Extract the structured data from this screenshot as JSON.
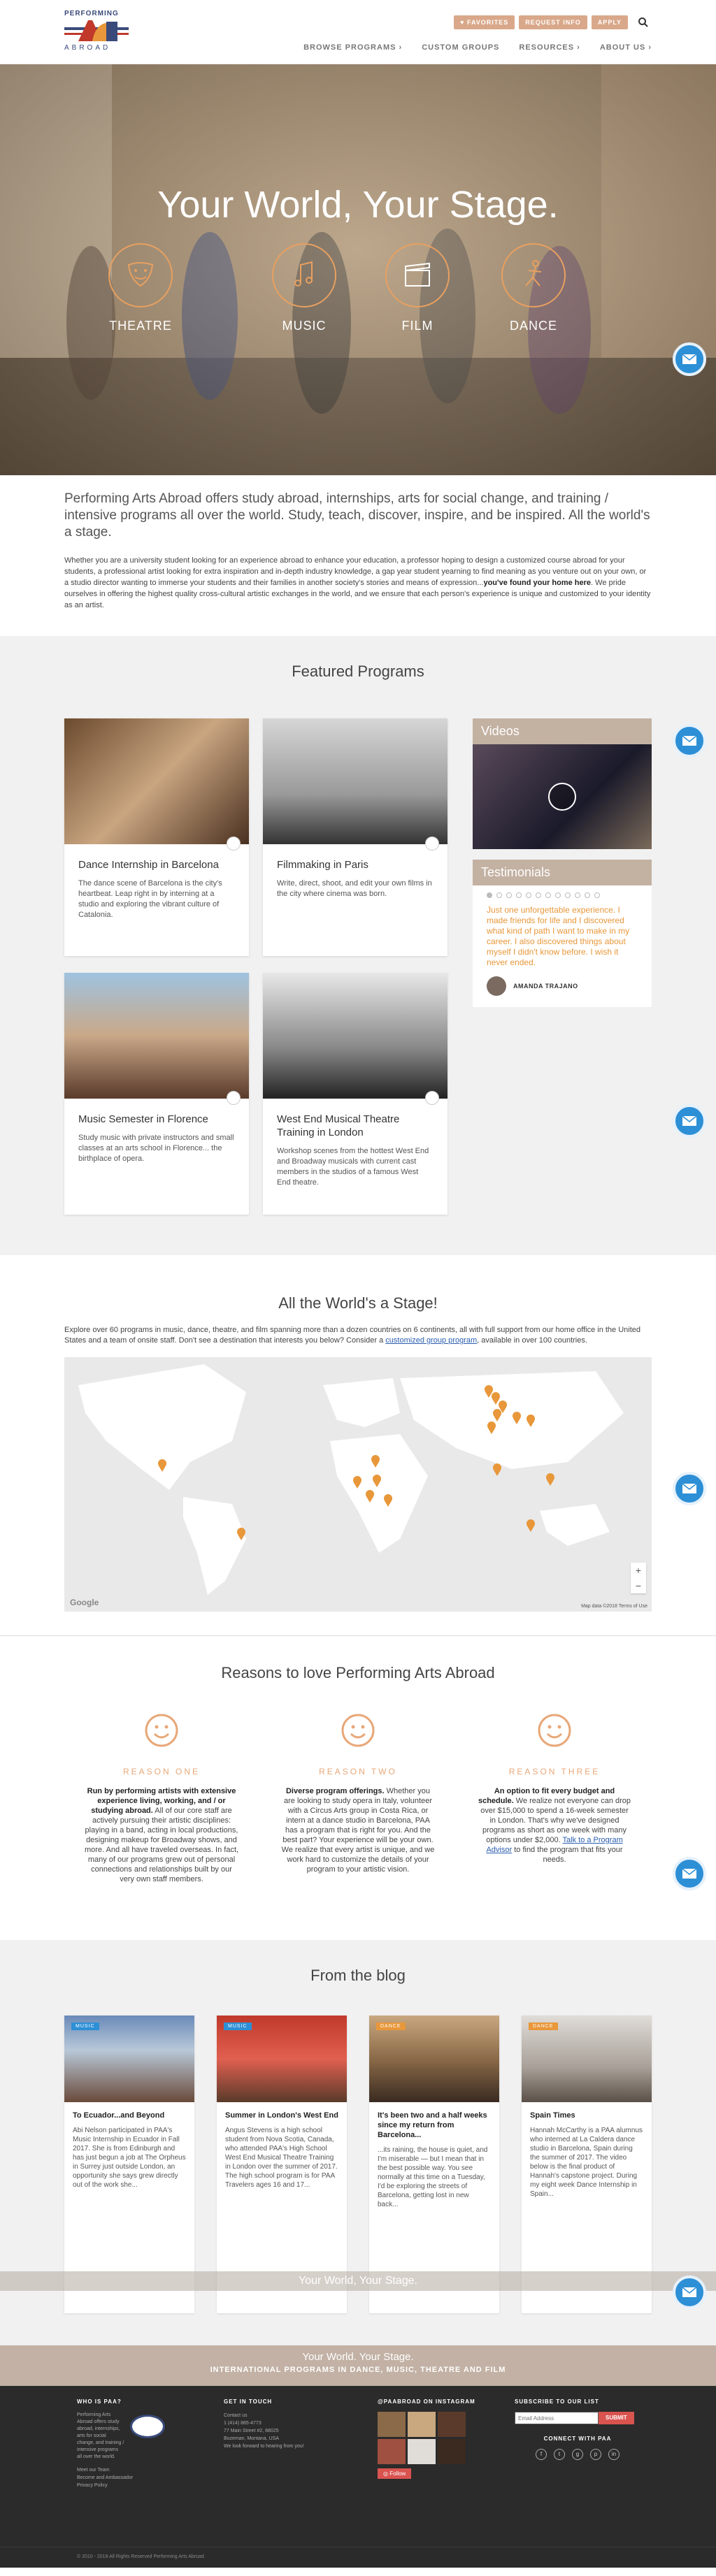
{
  "brand": {
    "logo_top": "PERFORMING",
    "logo_bottom": "ABROAD",
    "accent": "#d9a88a",
    "orange": "#e8973a",
    "blue": "#2d8fd6"
  },
  "header": {
    "util_buttons": [
      "FAVORITES",
      "REQUEST INFO",
      "APPLY"
    ],
    "nav": [
      "BROWSE PROGRAMS",
      "CUSTOM GROUPS",
      "RESOURCES",
      "ABOUT US"
    ]
  },
  "hero": {
    "title": "Your World, Your Stage.",
    "disciplines": [
      "THEATRE",
      "MUSIC",
      "FILM",
      "DANCE"
    ]
  },
  "intro": {
    "lead": "Performing Arts Abroad offers study abroad, internships, arts for social change, and training / intensive programs all over the world. Study, teach, discover, inspire, and be inspired. All the world's a stage.",
    "body": "Whether you are a university student looking for an experience abroad to enhance your education, a professor hoping to design a customized course abroad for your students, a professional artist looking for extra inspiration and in-depth industry knowledge, a gap year student yearning to find meaning as you venture out on your own, or a studio director wanting to immerse your students and their families in another society's stories and means of expression...",
    "body_bold": "you've found your home here",
    "body_end": ". We pride ourselves in offering the highest quality cross-cultural artistic exchanges in the world, and we ensure that each person's experience is unique and customized to your identity as an artist."
  },
  "featured": {
    "title": "Featured Programs",
    "programs": [
      {
        "title": "Dance Internship in Barcelona",
        "desc": "The dance scene of Barcelona is the city's heartbeat. Leap right in by interning at a studio and exploring the vibrant culture of Catalonia."
      },
      {
        "title": "Filmmaking in Paris",
        "desc": "Write, direct, shoot, and edit your own films in the city where cinema was born."
      },
      {
        "title": "Music Semester in Florence",
        "desc": "Study music with private instructors and small classes at an arts school in Florence... the birthplace of opera."
      },
      {
        "title": "West End Musical Theatre Training in London",
        "desc": "Workshop scenes from the hottest West End and Broadway musicals with current cast members in the studios of a famous West End theatre."
      }
    ],
    "videos_label": "Videos",
    "testimonials_label": "Testimonials",
    "testimonial_quote": "Just one unforgettable experience. I made friends for life and I discovered what kind of path I want to make in my career. I also discovered things about myself I didn't know before. I wish it never ended.",
    "testimonial_author": "AMANDA TRAJANO"
  },
  "world": {
    "title": "All the World's a Stage!",
    "desc_start": "Explore over 60 programs in music, dance, theatre, and film spanning more than a dozen countries on 6 continents, all with full support from our home office in the United States and a team of onsite staff.  Don't see a destination that interests you below? Consider a ",
    "desc_link": "customized group program",
    "desc_end": ", available in over 100 countries.",
    "map_google": "Google",
    "map_footer": "Map data ©2018   Terms of Use",
    "zoom_in": "+",
    "zoom_out": "−"
  },
  "reasons": {
    "title": "Reasons to love Performing Arts Abroad",
    "items": [
      {
        "label": "REASON ONE",
        "bold": "Run by performing artists with extensive experience living, working, and / or studying abroad.",
        "text": " All of our core staff are actively pursuing their artistic disciplines: playing in a band, acting in local productions, designing makeup for Broadway shows, and more. And all have traveled overseas. In fact, many of our programs grew out of personal connections and relationships built by our very own staff members.",
        "link": ""
      },
      {
        "label": "REASON TWO",
        "bold": "Diverse program offerings.",
        "text": " Whether you are looking to study opera in Italy, volunteer with a Circus Arts group in Costa Rica, or intern at a dance studio in Barcelona, PAA has a program that is right for you. And the best part? Your experience will be your own. We realize that every artist is unique, and we work hard to customize the details of your program to your artistic vision.",
        "link": ""
      },
      {
        "label": "REASON THREE",
        "bold": "An option to fit every budget and schedule.",
        "text": " We realize not everyone can drop over $15,000 to spend a 16-week semester in London. That's why we've designed programs as short as one week with many options under $2,000. ",
        "link": "Talk to a Program Advisor",
        "after": " to find the program that fits your needs."
      }
    ]
  },
  "blog": {
    "title": "From the blog",
    "posts": [
      {
        "tag": "MUSIC",
        "title": "To Ecuador...and Beyond",
        "excerpt": "Abi Nelson participated in PAA's Music Internship in Ecuador in Fall 2017. She is from Edinburgh and has just begun a job at The Orpheus in Surrey just outside London, an opportunity she says grew directly out of the work she..."
      },
      {
        "tag": "MUSIC",
        "title": "Summer in London's West End",
        "excerpt": "Angus Stevens is a high school student from Nova Scotia, Canada, who attended PAA's High School West End Musical Theatre Training in London over the summer of 2017. The high school program is for PAA Travelers ages 16 and 17..."
      },
      {
        "tag": "DANCE",
        "title": "It's been two and a half weeks since my return from Barcelona...",
        "excerpt": "...its raining, the house is quiet, and I'm miserable — but I mean that in the best possible way. You see normally at this time on a Tuesday, I'd be exploring the streets of Barcelona, getting lost in new back..."
      },
      {
        "tag": "DANCE",
        "title": "Spain Times",
        "excerpt": "Hannah McCarthy is a PAA alumnus who interned at La Caldera dance studio in Barcelona, Spain during the summer of 2017. The video below is the final product of Hannah's capstone project. During my eight week Dance Internship in Spain..."
      }
    ],
    "overlay_text": "Your World, Your Stage."
  },
  "band": {
    "line1": "Your World. Your Stage.",
    "line2": "INTERNATIONAL PROGRAMS IN DANCE, MUSIC, THEATRE AND FILM"
  },
  "footer": {
    "who_title": "WHO IS PAA?",
    "who_text": "Performing Arts Abroad offers study abroad, internships, arts for social change, and training / intensive programs all over the world.",
    "who_links": [
      "Meet our Team",
      "Become and Ambassador",
      "Privacy Policy"
    ],
    "contact_title": "GET IN TOUCH",
    "contact_lines": [
      "Contact us",
      "1 (414) 885-4773",
      "77 Main Street #2, 88025",
      "Bozeman, Montana, USA",
      "We look forward to hearing from you!"
    ],
    "ig_title": "@PAABROAD ON INSTAGRAM",
    "ig_follow": "Follow",
    "sub_title": "SUBSCRIBE TO OUR LIST",
    "email_placeholder": "Email Address",
    "submit": "SUBMIT",
    "connect_title": "CONNECT WITH PAA",
    "social_icons": [
      "f",
      "t",
      "g",
      "p",
      "in"
    ],
    "copyright": "© 2010 - 2018 All Rights Reserved Performing Arts Abroad"
  }
}
